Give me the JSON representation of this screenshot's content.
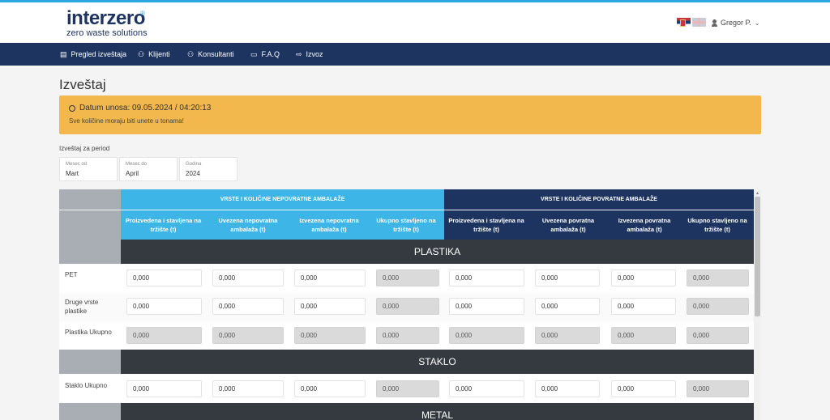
{
  "header": {
    "brand": "interzero",
    "registered": "®",
    "tagline": "zero waste solutions",
    "user_name": "Gregor P.",
    "user_caret": "⌄"
  },
  "nav": [
    {
      "label": "Pregled izveštaja",
      "icon": "document-icon"
    },
    {
      "label": "Klijenti",
      "icon": "users-icon"
    },
    {
      "label": "Konsultanti",
      "icon": "users-icon"
    },
    {
      "label": "F.A.Q",
      "icon": "chat-icon"
    },
    {
      "label": "Izvoz",
      "icon": "export-icon"
    }
  ],
  "page": {
    "title": "Izveštaj"
  },
  "alert": {
    "date_label": "Datum unosa: 09.05.2024 / 04:20:13",
    "note": "Sve količine moraju biti unete u tonama!",
    "color": "#f2b84e"
  },
  "period": {
    "label": "Izveštaj za period",
    "from_label": "Mesec od",
    "from_value": "Mart",
    "to_label": "Mesec do",
    "to_value": "April",
    "year_label": "Godina",
    "year_value": "2024"
  },
  "table": {
    "group_nonreturnable": "VRSTE I KOLIČINE NEPOVRATNE AMBALAŽE",
    "group_returnable": "VRSTE I KOLIČINE POVRATNE AMBALAŽE",
    "columns": [
      "Proizvedena i stavljena na tržište (t)",
      "Uvezena nepovratna ambalaža (t)",
      "Izvezena nepovratna ambalaža (t)",
      "Ukupno stavljeno na tržište (t)",
      "Proizvedena i stavljena na tržište (t)",
      "Uvezena povratna ambalaža (t)",
      "Izvezena povratna ambalaža (t)",
      "Ukupno stavljeno na tržište (t)"
    ],
    "sections": {
      "plastika": "PLASTIKA",
      "staklo": "STAKLO",
      "metal": "METAL"
    },
    "rows": {
      "pet": {
        "label": "PET",
        "values": [
          "0,000",
          "0,000",
          "0,000",
          "0,000",
          "0,000",
          "0,000",
          "0,000",
          "0,000"
        ]
      },
      "druge": {
        "label": "Druge vrste plastike",
        "values": [
          "0,000",
          "0,000",
          "0,000",
          "0,000",
          "0,000",
          "0,000",
          "0,000",
          "0,000"
        ]
      },
      "plastika_ukupno": {
        "label": "Plastika Ukupno",
        "values": [
          "0,000",
          "0,000",
          "0,000",
          "0,000",
          "0,000",
          "0,000",
          "0,000",
          "0,000"
        ]
      },
      "staklo_ukupno": {
        "label": "Staklo Ukupno",
        "values": [
          "0,000",
          "0,000",
          "0,000",
          "0,000",
          "0,000",
          "0,000",
          "0,000",
          "0,000"
        ]
      }
    }
  }
}
